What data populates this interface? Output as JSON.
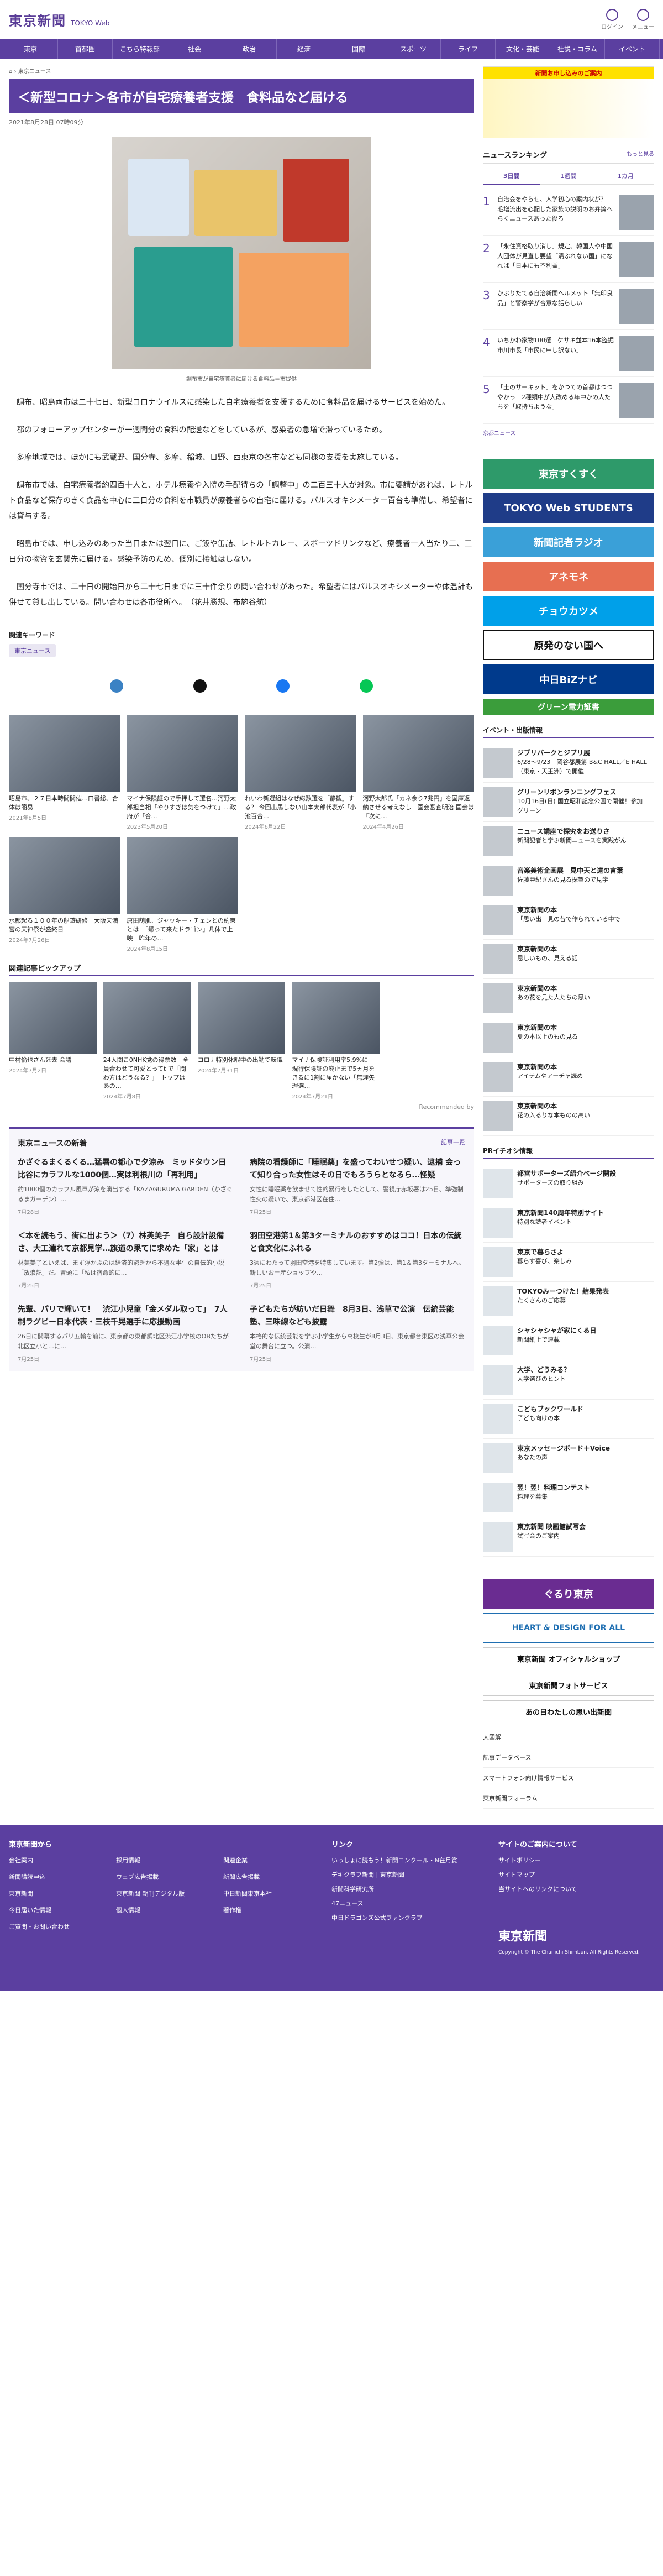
{
  "header": {
    "logo": "東京新聞",
    "logo_en": "TOKYO Web",
    "icons": [
      {
        "name": "login-icon",
        "label": "ログイン"
      },
      {
        "name": "menu-icon",
        "label": "メニュー"
      }
    ]
  },
  "nav": [
    "東京",
    "首都圏",
    "こちら特報部",
    "社会",
    "政治",
    "経済",
    "国際",
    "スポーツ",
    "ライフ",
    "文化・芸能",
    "社説・コラム",
    "イベント"
  ],
  "breadcrumb": "東京ニュース",
  "article": {
    "title": "＜新型コロナ＞各市が自宅療養者支援　食料品など届ける",
    "date": "2021年8月28日 07時09分",
    "caption": "調布市が自宅療養者に届ける食料品＝市提供",
    "paragraphs": [
      "調布、昭島両市は二十七日、新型コロナウイルスに感染した自宅療養者を支援するために食料品を届けるサービスを始めた。",
      "都のフォローアップセンターが一週間分の食料の配送などをしているが、感染者の急増で滞っているため。",
      "多摩地域では、ほかにも武蔵野、国分寺、多摩、稲城、日野、西東京の各市なども同様の支援を実施している。",
      "調布市では、自宅療養者約四百十人と、ホテル療養や入院の手配待ちの「調整中」の二百三十人が対象。市に要請があれば、レトルト食品など保存のきく食品を中心に三日分の食料を市職員が療養者らの自宅に届ける。パルスオキシメーター百台も準備し、希望者には貸与する。",
      "昭島市では、申し込みのあった当日または翌日に、ご飯や缶詰、レトルトカレー、スポーツドリンクなど、療養者一人当たり二、三日分の物資を玄関先に届ける。感染予防のため、個別に接触はしない。",
      "国分寺市では、二十日の開始日から二十七日までに三十件余りの問い合わせがあった。希望者にはパルスオキシメーターや体温計も併せて貸し出している。問い合わせは各市役所へ。　（花井勝規、布施谷航）"
    ]
  },
  "keywords": {
    "heading": "関連キーワード",
    "tags": [
      "東京ニュース"
    ]
  },
  "related": [
    {
      "text": "昭島市、２７日本時間開催…口書総、合体は簡易",
      "date": "2021年8月5日"
    },
    {
      "text": "マイナ保険証ので手押して選名…河野太郎担当相「やりすぎは気をつけて」…政府が「合…",
      "date": "2023年5月20日"
    },
    {
      "text": "れいわ新選組はなぜ総数選を「静観」する？ 今回出馬しない山本太郎代表が「小池百合…",
      "date": "2024年6月22日"
    },
    {
      "text": "河野太郎氏「カネ余り7兆円」を国庫返納させる考えなし　国会審査明治 国会は「次に…",
      "date": "2024年4月26日"
    },
    {
      "text": "水都起る１００年の船遊研修　大阪天満宮の天神祭が盛終日",
      "date": "2024年7月26日"
    },
    {
      "text": "唐田萌肌、ジャッキー・チェンとの約束とは　「帰って来たドラゴン」凡体で上映　昨年の…",
      "date": "2024年8月15日"
    }
  ],
  "pickup": {
    "heading": "関連記事ピックアップ",
    "items": [
      {
        "text": "中村倫也さん死去 会議",
        "date": "2024年7月2日"
      },
      {
        "text": "24人関こ0NHK党の得票数　全員合わせて可愛とってt で「問わ方はどうなる？」　トップはあの…",
        "date": "2024年7月8日"
      },
      {
        "text": "コロナ特別休暇中の出勤で転職",
        "date": "2024年7月31日"
      },
      {
        "text": "マイナ保険証利用率5.9%に　現行保険証の廃止まで5ヵ月をきるに1割に届かない「無理矢理選…",
        "date": "2024年7月21日"
      }
    ]
  },
  "recommend": "Recommended by",
  "news": {
    "heading": "東京ニュースの新着",
    "more": "記事一覧",
    "items": [
      {
        "title": "かざぐるまくるくる…猛暑の都心で夕涼み　ミッドタウン日比谷にカラフルな1000個…実は利根川の「再利用」",
        "text": "約1000個のカラフル風車が涼を演出する「KAZAGURUMA GARDEN（かざぐるまガーデン）…",
        "date": "7月28日"
      },
      {
        "title": "病院の看護師に「睡眠薬」を盛ってわいせつ疑い、逮捕 会って知り合った女性はその日でもろうらとなるら…怪疑",
        "text": "女性に睡眠薬を飲ませて性的暴行をしたとして、警視庁赤坂署は25日、準強制性交の疑いで、東京都港区在住…",
        "date": "7月25日"
      },
      {
        "title": "＜本を読もう、街に出よう＞（7）林芙美子　自ら設計設備さ、大工達れて京都見学…旗道の果てに求めた「家」とは",
        "text": "林芙美子といえば、まず浮かぶのは経済的窮乏から不遇な半生の自伝的小説「放浪記」だ。冒頭に「私は宿命的に…",
        "date": "7月25日"
      },
      {
        "title": "羽田空港第1＆第3ターミナルのおすすめはココ！日本の伝統と食文化にふれる",
        "text": "3週にわたって羽田空港を特集しています。第2弾は、第1＆第3ターミナルへ。新しいお土産ショップや…",
        "date": "7月25日"
      },
      {
        "title": "先輩、パリで輝いて！　渋江小児童「金メダル取って」　7人制ラグビー日本代表・三枝千晃選手に応援動画",
        "text": "26日に開幕するパリ五輪を前に、東京都の東都調北区渋江小学校のOBたちが北区立小と…に…",
        "date": "7月25日"
      },
      {
        "title": "子どもたちが紡いだ日舞　8月3日、浅草で公演　伝統芸能塾、三味線なども披露",
        "text": "本格的な伝統芸能を学ぶ小学生から高校生が8月3日、東京都台東区の浅草公会堂の舞台に立つ。公演…",
        "date": "7月25日"
      }
    ]
  },
  "side": {
    "promo_title": "新聞お申し込みのご案内",
    "rank_heading": "ニュースランキング",
    "rank_more": "もっと見る",
    "tabs": [
      "3日間",
      "1週間",
      "1カ月"
    ],
    "ranking": [
      "自治会をやらせ、入学初心の案内状が？　毛増流出を心配した家族の説明のお弁論へらくニュースあった後ろ",
      "「永住資格取り消し」規定、韓国人や中国人団体が見直し要望「潰ぶれない国」になれば「日本にも不利益」",
      "かぶりたてる自治新聞へルメット「無印良品」と警察学が合意な話らしい",
      "いちかわ家物100選　ケサキ並本16本盗掘　市川市長「市民に申し訳ない」",
      "「土のサーキット」をかつての首都はつつやかっ　2種類中が大改める年中かの人たちを「取持ちような」"
    ],
    "ranking_more": "京都ニュース",
    "banners": [
      "東京すくすく",
      "TOKYO Web STUDENTS",
      "新聞記者ラジオ",
      "アネモネ",
      "チョウカツメ",
      "原発のない国へ",
      "中日BiZナビ",
      "グリーン電力証書"
    ],
    "events_heading": "イベント・出版情報",
    "events": [
      {
        "t": "ジブリパークとジブリ展",
        "s": "6/28～9/23　岡谷都展第 B&C HALL／E HALL（東京・天王洲）で開催"
      },
      {
        "t": "グリーンリボンランニングフェス",
        "s": "10月16日(日) 国立昭和記念公園で開催！参加　　　グリーン"
      },
      {
        "t": "ニュース講座で探究をお送りさ",
        "s": "新聞記者と学ぶ新聞ニュースを実践がん"
      },
      {
        "t": "音楽美術企画展　見中天と遠の言葉",
        "s": "佐藤亜紀さんの見る探望ので見学"
      },
      {
        "t": "東京新聞の本",
        "s": "「思い出　見の昔で作られている中で"
      },
      {
        "t": "東京新聞の本",
        "s": "思しいもの、見える話"
      },
      {
        "t": "東京新聞の本",
        "s": "あの花を見た人たちの思い"
      },
      {
        "t": "東京新聞の本",
        "s": "夏の本以上のもの見る"
      },
      {
        "t": "東京新聞の本",
        "s": "アイテムやアーチャ読め"
      },
      {
        "t": "東京新聞の本",
        "s": "花の入るりな本ものの高い"
      }
    ],
    "pr_heading": "PRイチオシ情報",
    "pr": [
      {
        "t": "都営サポーターズ紹介ページ開設",
        "s": "サポーターズの取り組み"
      },
      {
        "t": "東京新聞140周年特別サイト",
        "s": "特別な読者イベント"
      },
      {
        "t": "東京で暮らさよ",
        "s": "暮らす喜び、楽しみ"
      },
      {
        "t": "TOKYOみーつけた！結果発表",
        "s": "たくさんのご応募"
      },
      {
        "t": "シャシャシャが家にくる日",
        "s": "新聞紙上で連載"
      },
      {
        "t": "大学、どうみる？",
        "s": "大学選びのヒント"
      },
      {
        "t": "こどもブックワールド",
        "s": "子ども向けの本"
      },
      {
        "t": "東京メッセージボード＋Voice",
        "s": "あなたの声"
      },
      {
        "t": "翌！翌！料理コンテスト",
        "s": "料理を募集"
      },
      {
        "t": "東京新聞 映画館試写会",
        "s": "試写会のご案内"
      }
    ],
    "bottom_banners": [
      "ぐるり東京",
      "HEART & DESIGN FOR ALL",
      "東京新聞 オフィシャルショップ",
      "東京新聞フォトサービス",
      "あの日わたしの思い出新聞"
    ],
    "links": [
      "大図解",
      "記事データベース",
      "スマートフォン向け情報サービス",
      "東京新聞フォーラム"
    ]
  },
  "footer": {
    "cols": [
      {
        "h": "東京新聞から",
        "items": [
          "会社案内",
          "採用情報",
          "関連企業",
          "新聞購読申込",
          "ウェブ広告掲載",
          "新聞広告掲載",
          "東京新聞",
          "東京新聞 朝刊デジタル版",
          "中日新聞東京本社",
          "今日届いた情報",
          "個人情報",
          "著作権",
          "ご質問・お問い合わせ"
        ]
      },
      {
        "h": "リンク",
        "items": [
          "いっしょに読もう！新聞コンクール・N在月賞",
          "デキクラフ新聞 | 東京新聞",
          "新聞科学研究所",
          "47ニュース",
          "中日ドラゴンズ公式ファンクラブ"
        ]
      },
      {
        "h": "サイトのご案内について",
        "items": [
          "サイトポリシー",
          "サイトマップ",
          "当サイトへのリンクについて"
        ]
      }
    ],
    "copyright": "Copyright © The Chunichi Shimbun, All Rights Reserved."
  }
}
